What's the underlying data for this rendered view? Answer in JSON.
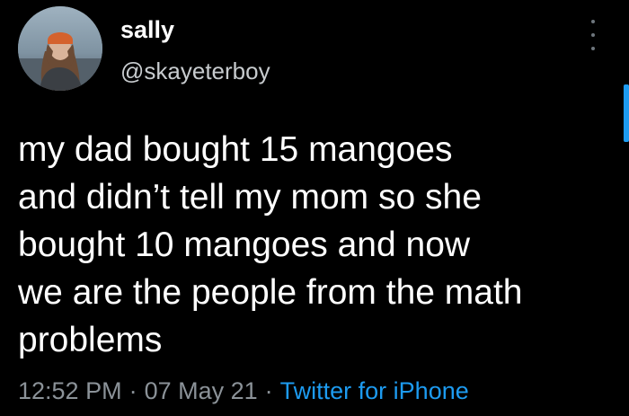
{
  "tweet": {
    "author": {
      "display_name": "sally",
      "handle": "@skayeterboy"
    },
    "text": "my dad bought 15 mangoes\nand didn’t tell my mom so she\nbought 10 mangoes and now\nwe are the people from the math\nproblems",
    "time": "12:52 PM",
    "date": "07 May 21",
    "source": "Twitter for iPhone",
    "separator": "·"
  },
  "icons": {
    "more": "more-vertical-icon"
  },
  "colors": {
    "background": "#000000",
    "text": "#ffffff",
    "secondary": "#8b9298",
    "accent": "#1d9bf0"
  }
}
